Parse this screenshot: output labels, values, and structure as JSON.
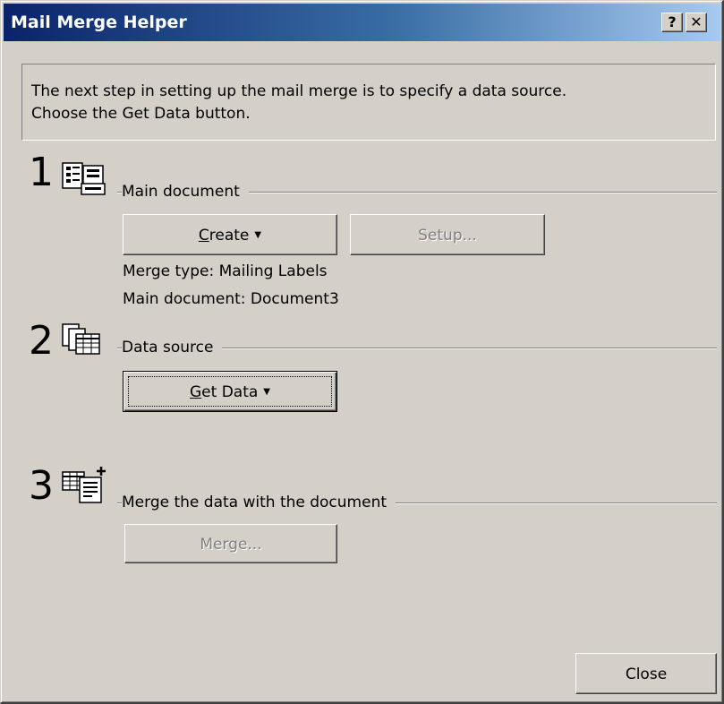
{
  "window": {
    "title": "Mail Merge Helper",
    "help_button": "?",
    "close_button": "✕"
  },
  "instructions": {
    "line1": "The next step in setting up the mail merge is to specify a data source.",
    "line2": "Choose the Get Data button."
  },
  "steps": [
    {
      "number": "1",
      "icon": "main-document-icon",
      "label": "Main document",
      "buttons": [
        {
          "prefix": "",
          "mnemonic": "C",
          "rest": "reate",
          "dropdown": true,
          "enabled": true
        },
        {
          "label": "Setup...",
          "enabled": false
        }
      ],
      "details": [
        "Merge type: Mailing Labels",
        "Main document: Document3"
      ]
    },
    {
      "number": "2",
      "icon": "data-source-icon",
      "label": "Data source",
      "buttons": [
        {
          "prefix": "",
          "mnemonic": "G",
          "rest": "et Data",
          "dropdown": true,
          "enabled": true,
          "focused": true
        }
      ]
    },
    {
      "number": "3",
      "icon": "merge-icon",
      "label": "Merge the data with the document",
      "buttons": [
        {
          "label": "Merge...",
          "enabled": false
        }
      ]
    }
  ],
  "footer": {
    "close_label": "Close"
  }
}
